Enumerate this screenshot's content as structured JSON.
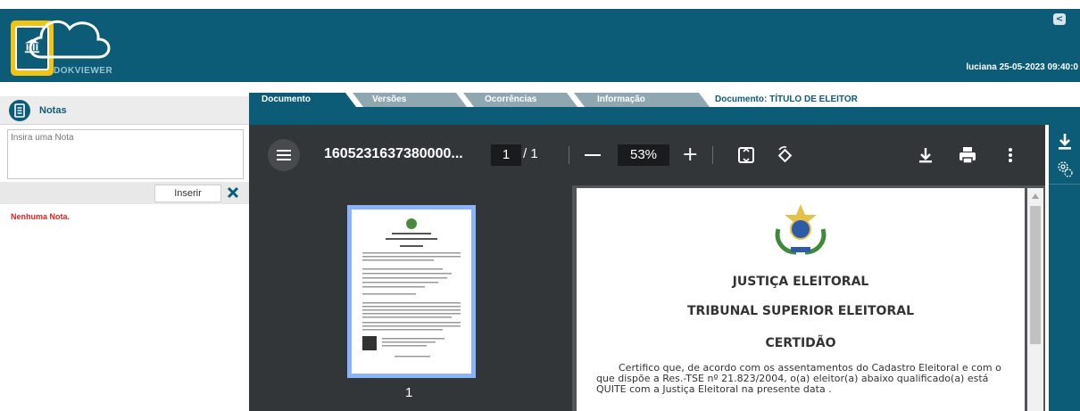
{
  "header": {
    "logo_text": "DOKVIEWER",
    "user_info": "luciana 25-05-2023 09:40:0",
    "collapse_label": "<"
  },
  "notes": {
    "title": "Notas",
    "input_placeholder": "Insira uma Nota",
    "insert_label": "Inserir",
    "empty_text": "Nenhuma Nota."
  },
  "tabs": [
    {
      "label": "Documento",
      "active": true
    },
    {
      "label": "Versões",
      "active": false
    },
    {
      "label": "Ocorrências",
      "active": false
    },
    {
      "label": "Informação",
      "active": false
    }
  ],
  "document_title": "Documento: TÍTULO DE ELEITOR",
  "pdf": {
    "filename": "1605231637380000...",
    "current_page": "1",
    "page_count": "/ 1",
    "zoom": "53%",
    "thumbnail_number": "1"
  },
  "document": {
    "heading1": "JUSTIÇA ELEITORAL",
    "heading2": "TRIBUNAL SUPERIOR ELEITORAL",
    "heading3": "CERTIDÃO",
    "body": "Certifico que, de acordo com os assentamentos do Cadastro Eleitoral e com o que dispõe a Res.-TSE nº 21.823/2004, o(a) eleitor(a) abaixo qualificado(a) está QUITE com a Justiça Eleitoral na presente data ."
  },
  "colors": {
    "brand": "#0c5c78",
    "accent": "#f3c312",
    "pdf_toolbar": "#323639",
    "error": "#e02020"
  }
}
